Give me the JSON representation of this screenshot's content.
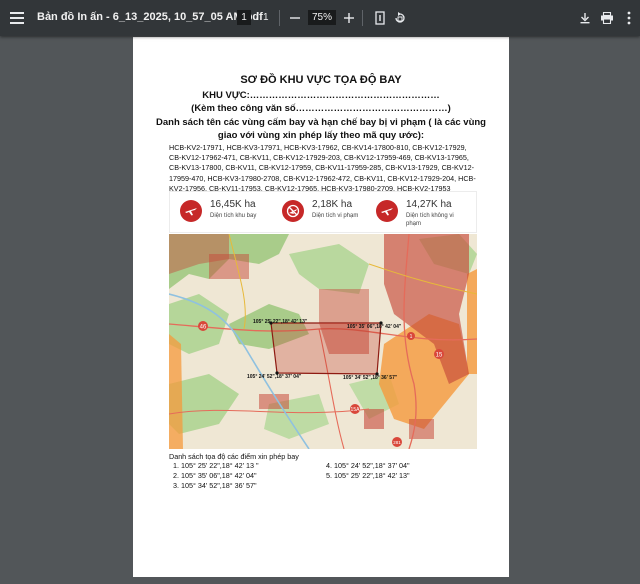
{
  "toolbar": {
    "title": "Bản đồ In ấn - 6_13_2025, 10_57_05 AM.pdf",
    "page_current": "1",
    "page_separator": "/",
    "page_total": "1",
    "zoom": "75%",
    "icons": [
      "menu-icon",
      "zoom-out-icon",
      "zoom-in-icon",
      "fit-page-icon",
      "rotate-icon",
      "download-icon",
      "print-icon",
      "more-vert-icon"
    ]
  },
  "document": {
    "title": "SƠ ĐỒ KHU VỰC TỌA ĐỘ BAY",
    "khu_vuc": "KHU VỰC:……………………………………………………",
    "kem_theo": "(Kèm theo công văn số…………………………………………)",
    "danh_sach_line1": "Danh sách tên các vùng cấm bay và hạn chế bay bị vi phạm ( là các vùng",
    "danh_sach_line2": "giao với vùng xin phép lấy theo mã quy ước):",
    "codes_text": "HCB-KV2-17971, HCB-KV3-17971, HCB-KV3-17962, CB-KV14-17800-810, CB-KV12-17929, CB-KV12-17962-471, CB-KV11, CB-KV12-17929-203, CB-KV12-17959-469, CB-KV13-17965, CB-KV13-17800, CB-KV11, CB-KV12-17959, CB-KV11-17959-285, CB-KV13-17929, CB-KV12-17959-470, HCB-KV3-17980-2708, CB-KV12-17962-472, CB-KV11, CB-KV12-17929-204, HCB-KV2-17956, CB-KV11-17953, CB-KV12-17965, HCB-KV3-17980-2709, HCB-KV2-17953",
    "stats": [
      {
        "value": "16,45K ha",
        "label": "Diện tích khu bay",
        "icon": "plane-icon"
      },
      {
        "value": "2,18K ha",
        "label": "Diện tích vi phạm",
        "icon": "no-fly-icon"
      },
      {
        "value": "14,27K ha",
        "label_line1": "Diện tích không vi",
        "label_line2": "phạm",
        "icon": "plane-check-icon"
      }
    ],
    "map_labels": {
      "tl": "105° 25' 22\",18° 42' 13\"",
      "tr": "105° 35' 06\",18° 42' 04\"",
      "bl": "105° 24' 52\",18° 37' 04\"",
      "br": "105° 34' 52\",18° 36' 57\"",
      "road1": "46",
      "road2": "15",
      "road3": "1",
      "road4": "15A",
      "road5": "281"
    },
    "coords_title": "Danh sách tọa độ các điểm xin phép bay",
    "coords": [
      "1. 105° 25' 22\",18° 42' 13 \"",
      "2. 105° 35' 06\",18° 42' 04\"",
      "3. 105° 34' 52\",18° 36' 57\"",
      "4. 105° 24' 52\",18° 37' 04\"",
      "5. 105° 25' 22\",18° 42' 13\""
    ]
  },
  "colors": {
    "toolbar_bg": "#323639",
    "viewer_bg": "#525659",
    "accent_red": "#c62828",
    "orange_zone": "#f59a3c",
    "violation_zone": "#b3261e"
  }
}
